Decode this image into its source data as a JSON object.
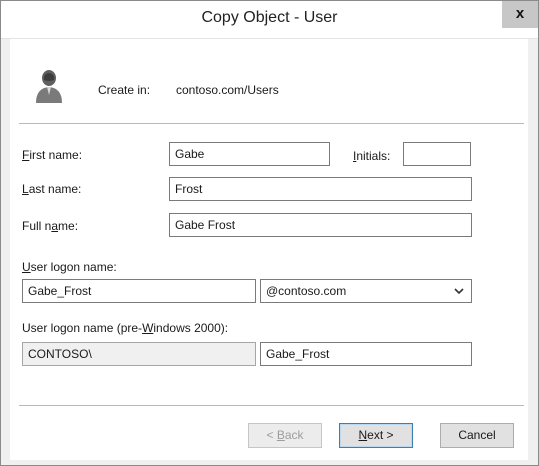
{
  "window": {
    "title": "Copy Object - User",
    "close_label": "x"
  },
  "create_in": {
    "label": "Create in:",
    "value": "contoso.com/Users"
  },
  "form": {
    "first_name": {
      "label": "First name:",
      "mnemonic": "F",
      "rest": "irst name:",
      "value": "Gabe"
    },
    "initials": {
      "mnemonic": "I",
      "rest": "nitials:",
      "value": ""
    },
    "last_name": {
      "mnemonic": "L",
      "rest": "ast name:",
      "value": "Frost"
    },
    "full_name": {
      "pre": "Full n",
      "mnemonic": "a",
      "rest": "me:",
      "value": "Gabe Frost"
    },
    "logon_name": {
      "mnemonic": "U",
      "rest": "ser logon name:",
      "value": "Gabe_Frost",
      "domain_selected": "@contoso.com"
    },
    "pre2000": {
      "pre": "User logon name (pre-",
      "mnemonic": "W",
      "rest": "indows 2000):",
      "domain_prefix": "CONTOSO\\",
      "value": "Gabe_Frost"
    }
  },
  "buttons": {
    "back": {
      "pre": "< ",
      "mnemonic": "B",
      "rest": "ack"
    },
    "next": {
      "mnemonic": "N",
      "rest": "ext >"
    },
    "cancel": "Cancel"
  },
  "icons": {
    "user": "user-icon",
    "dropdown": "chevron-down-icon",
    "close": "close-icon"
  }
}
